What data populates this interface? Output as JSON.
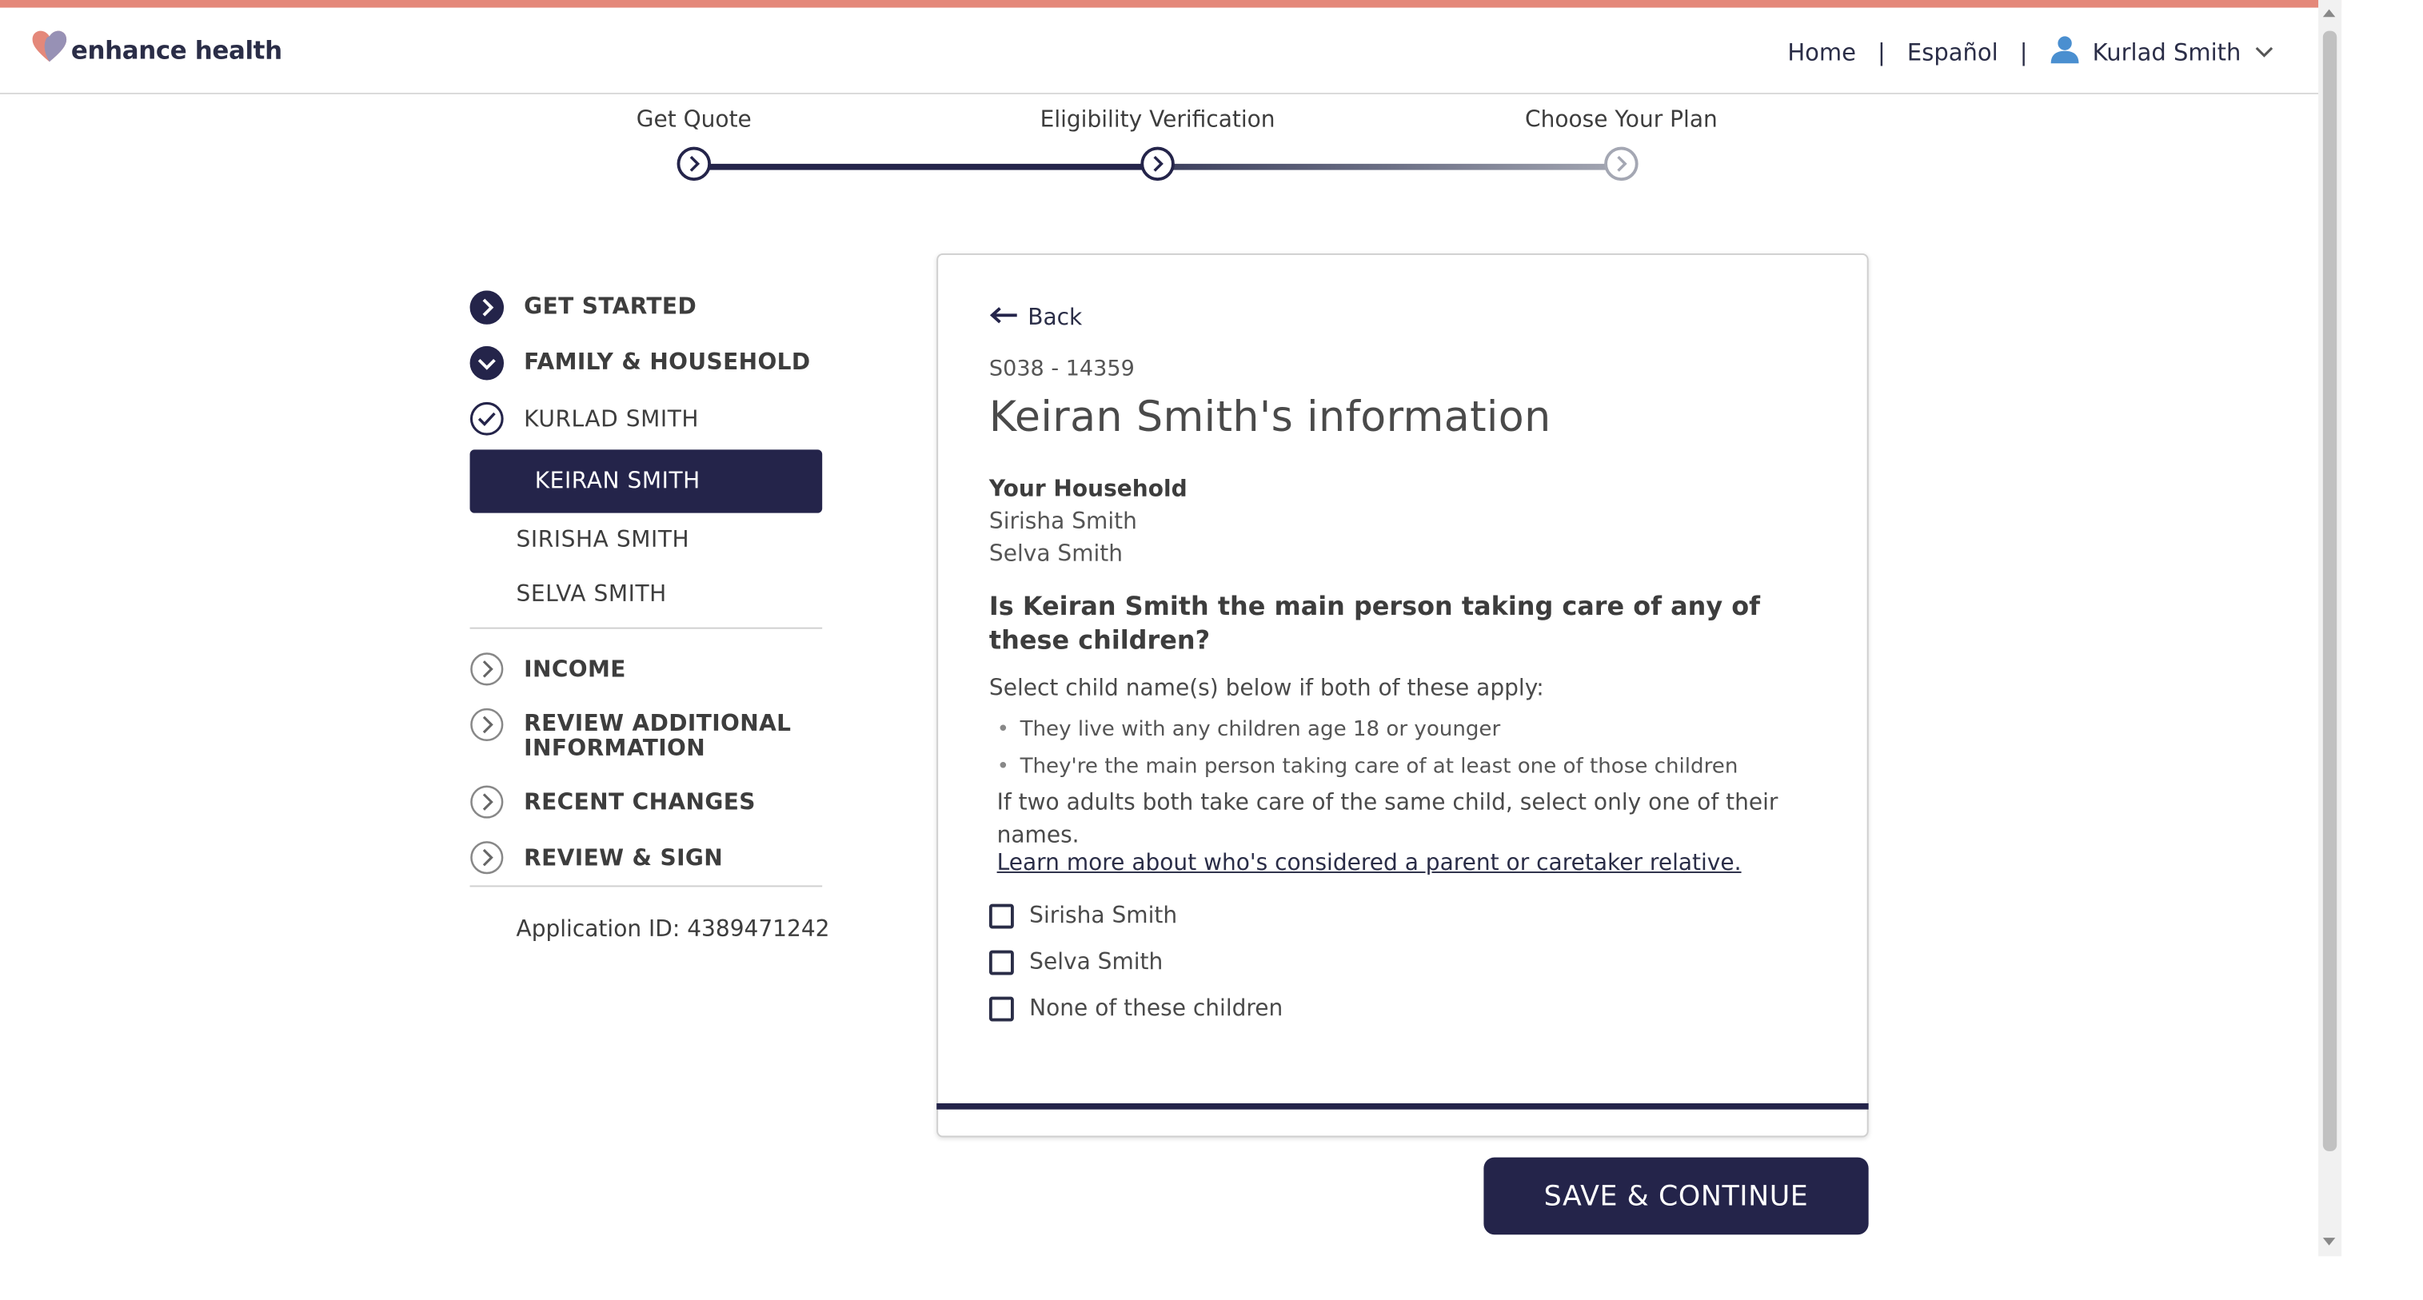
{
  "colors": {
    "brand_navy": "#24244a",
    "accent_coral": "#e4887a",
    "text": "#3d3d3d"
  },
  "header": {
    "logo_text": "enhance health",
    "nav": {
      "home": "Home",
      "language": "Español",
      "user_name": "Kurlad Smith"
    },
    "icons": [
      "heart-logo-icon",
      "user-icon",
      "chevron-down-icon"
    ]
  },
  "stepper": {
    "steps": [
      {
        "label": "Get Quote",
        "state": "complete"
      },
      {
        "label": "Eligibility Verification",
        "state": "current"
      },
      {
        "label": "Choose Your Plan",
        "state": "upcoming"
      }
    ]
  },
  "sidebar": {
    "sections": [
      {
        "label": "GET STARTED",
        "icon": "chevron-right-filled-icon"
      },
      {
        "label": "FAMILY & HOUSEHOLD",
        "icon": "chevron-down-filled-icon"
      },
      {
        "label": "KURLAD SMITH",
        "icon": "check-circle-icon"
      },
      {
        "label": "INCOME",
        "icon": "chevron-right-outline-icon"
      },
      {
        "label": "REVIEW ADDITIONAL INFORMATION",
        "icon": "chevron-right-outline-icon"
      },
      {
        "label": "RECENT CHANGES",
        "icon": "chevron-right-outline-icon"
      },
      {
        "label": "REVIEW & SIGN",
        "icon": "chevron-right-outline-icon"
      }
    ],
    "members": [
      {
        "label": "KEIRAN SMITH",
        "active": true
      },
      {
        "label": "SIRISHA SMITH",
        "active": false
      },
      {
        "label": "SELVA SMITH",
        "active": false
      }
    ],
    "application_id": "Application ID: 4389471242"
  },
  "form": {
    "back_label": "Back",
    "case_id": "S038 - 14359",
    "title": "Keiran Smith's information",
    "household_label": "Your Household",
    "household_members": [
      "Sirisha Smith",
      "Selva Smith"
    ],
    "question": "Is Keiran Smith the main person taking care of any of these children?",
    "instruction": "Select child name(s) below if both of these apply:",
    "bullets": [
      "They live with any children age 18 or younger",
      "They're the main person taking care of at least one of those children"
    ],
    "note": "If two adults both take care of the same child, select only one of their names.",
    "learn_more": "Learn more about who's considered a parent or caretaker relative.",
    "options": [
      {
        "label": "Sirisha Smith",
        "checked": false
      },
      {
        "label": "Selva Smith",
        "checked": false
      },
      {
        "label": "None of these children",
        "checked": false
      }
    ]
  },
  "actions": {
    "save_continue": "SAVE & CONTINUE"
  }
}
